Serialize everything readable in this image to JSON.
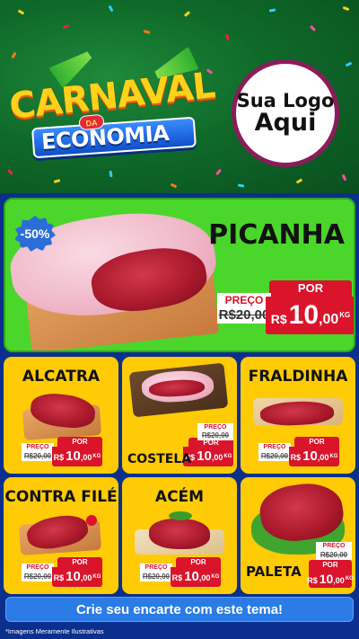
{
  "header": {
    "event_title_line1": "CARNAVAL",
    "event_title_connector": "DA",
    "event_title_line2": "ECONOMIA",
    "logo_line1": "Sua Logo",
    "logo_line2": "Aqui"
  },
  "featured": {
    "name": "PICANHA",
    "discount": "-50%",
    "price_label": "PREÇO",
    "old_price": "R$20,00",
    "por_label": "POR",
    "currency": "R$",
    "price_int": "10",
    "price_cents": ",00",
    "unit": "KG"
  },
  "products": [
    {
      "name": "ALCATRA",
      "price_label": "PREÇO",
      "old_price": "R$20,00",
      "por_label": "POR",
      "currency": "R$",
      "price_int": "10",
      "price_cents": ",00",
      "unit": "KG"
    },
    {
      "name": "COSTELA",
      "price_label": "PREÇO",
      "old_price": "R$20,00",
      "por_label": "POR",
      "currency": "R$",
      "price_int": "10",
      "price_cents": ",00",
      "unit": "KG"
    },
    {
      "name": "FRALDINHA",
      "price_label": "PREÇO",
      "old_price": "R$20,00",
      "por_label": "POR",
      "currency": "R$",
      "price_int": "10",
      "price_cents": ",00",
      "unit": "KG"
    },
    {
      "name": "CONTRA FILÉ",
      "price_label": "PREÇO",
      "old_price": "R$20,00",
      "por_label": "POR",
      "currency": "R$",
      "price_int": "10",
      "price_cents": ",00",
      "unit": "KG"
    },
    {
      "name": "ACÉM",
      "price_label": "PREÇO",
      "old_price": "R$20,00",
      "por_label": "POR",
      "currency": "R$",
      "price_int": "10",
      "price_cents": ",00",
      "unit": "KG"
    },
    {
      "name": "PALETA",
      "price_label": "PREÇO",
      "old_price": "R$20,00",
      "por_label": "POR",
      "currency": "R$",
      "price_int": "10",
      "price_cents": ",00",
      "unit": "KG"
    }
  ],
  "footer": {
    "cta": "Crie seu encarte com este tema!",
    "disclaimer": "*Imagens Meramente Ilustrativas"
  },
  "colors": {
    "header_green": "#0f6a2a",
    "hero_green": "#4bd62b",
    "card_yellow": "#ffcb05",
    "price_red": "#d9142b",
    "background_blue": "#0b2f8c",
    "cta_blue": "#2a7be6"
  }
}
